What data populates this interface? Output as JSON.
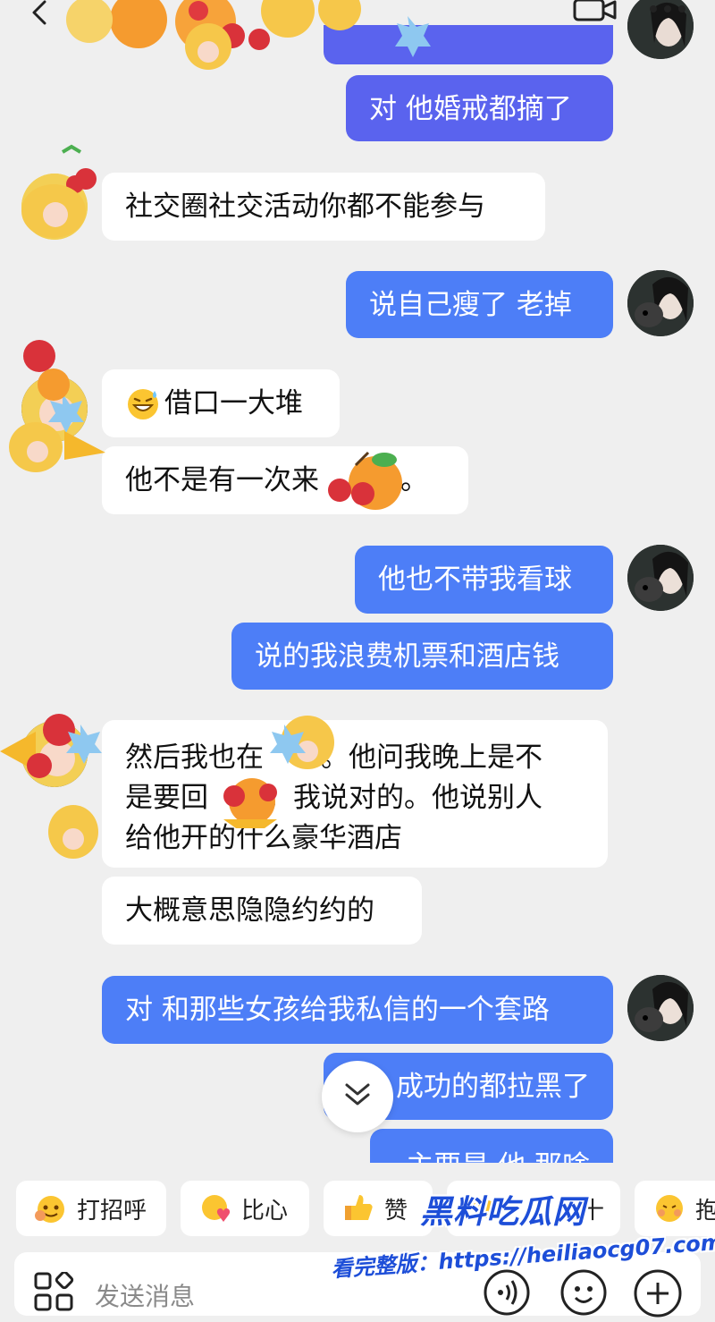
{
  "header": {
    "back_icon": "back-chevron-icon",
    "video_icon": "video-call-icon",
    "more_icon": "more-dots-icon"
  },
  "messages": [
    {
      "id": "m1",
      "side": "out",
      "text": "对 他婚戒都摘了"
    },
    {
      "id": "m2",
      "side": "in",
      "text": "社交圈社交活动你都不能参与"
    },
    {
      "id": "m3",
      "side": "out",
      "text": "说自己瘦了 老掉"
    },
    {
      "id": "m4",
      "side": "in",
      "emoji": "grin-sweat-emoji",
      "text": "借口一大堆"
    },
    {
      "id": "m5",
      "side": "in",
      "text": "他不是有一次来",
      "text_tail": "吗。"
    },
    {
      "id": "m6",
      "side": "out",
      "text": "他也不带我看球"
    },
    {
      "id": "m7",
      "side": "out",
      "text": "说的我浪费机票和酒店钱"
    },
    {
      "id": "m8",
      "side": "in",
      "lines": [
        "然后我也在",
        "。他问我晚上是不",
        "是要回",
        "。我说对的。他说别人",
        "给他开的什么豪华酒店"
      ]
    },
    {
      "id": "m9",
      "side": "in",
      "text": "大概意思隐隐约约的"
    },
    {
      "id": "m10",
      "side": "out",
      "text": "对 和那些女孩给我私信的一个套路"
    },
    {
      "id": "m11",
      "side": "out",
      "text": "成功的都拉黑了"
    },
    {
      "id": "m12",
      "side": "out",
      "text": "主要是 他 那啥"
    }
  ],
  "quick_replies": [
    {
      "label": "打招呼",
      "emoji": "hello-emoji"
    },
    {
      "label": "比心",
      "emoji": "heart-hands-emoji"
    },
    {
      "label": "赞",
      "emoji": "thumbs-up-emoji"
    },
    {
      "label": "十",
      "emoji": "fist-emoji"
    },
    {
      "label": "抱",
      "emoji": "hug-emoji"
    }
  ],
  "input": {
    "placeholder": "发送消息",
    "apps_icon": "apps-grid-icon",
    "voice_icon": "voice-icon",
    "emoji_icon": "emoji-face-icon",
    "plus_icon": "plus-icon"
  },
  "watermark": {
    "title": "黑料吃瓜网",
    "url": "看完整版：https://heiliaocg07.com"
  },
  "colors": {
    "background": "#efefef",
    "outgoing_bubble": "#4d7ef7",
    "outgoing_bubble_alt": "#5a63ee",
    "incoming_bubble": "#ffffff",
    "watermark": "#1d4ed8"
  }
}
